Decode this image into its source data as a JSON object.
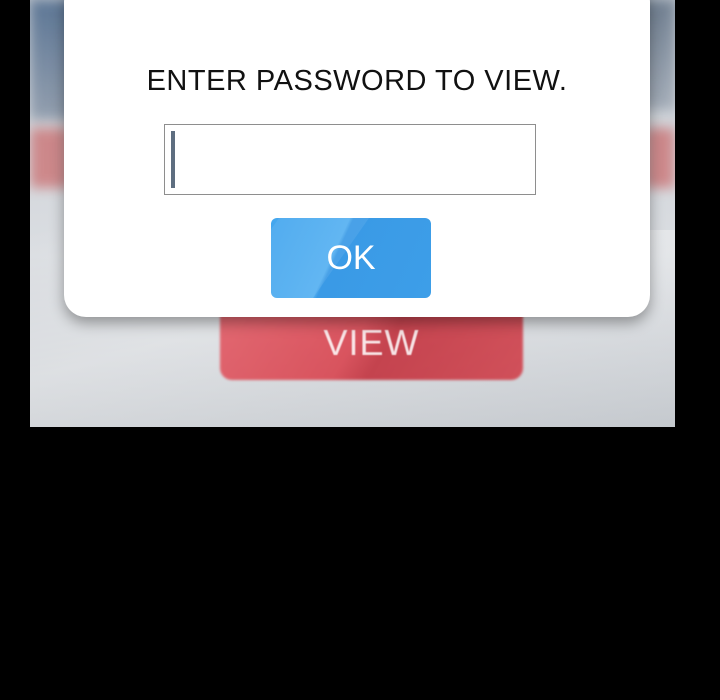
{
  "dialog": {
    "title": "ENTER PASSWORD TO VIEW.",
    "password_input": {
      "value": "",
      "placeholder": ""
    },
    "ok_label": "OK"
  },
  "background": {
    "view_button_label": "VIEW"
  },
  "colors": {
    "page_background": "#000000",
    "dialog_background": "#ffffff",
    "ok_button": "#43a6ee",
    "background_button": "#d9333f"
  }
}
